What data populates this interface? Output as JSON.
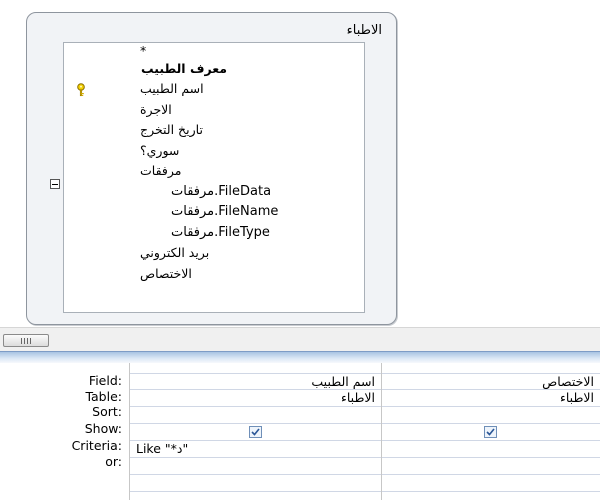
{
  "table_box": {
    "title": "الاطباء",
    "fields": [
      "*",
      "معرف الطبيب",
      "اسم الطبيب",
      "الاجرة",
      "تاريخ التخرج",
      "سوري؟",
      "مرفقات",
      "مرفقات.FileData",
      "مرفقات.FileName",
      "مرفقات.FileType",
      "بريد الكتروني",
      "الاختصاص"
    ]
  },
  "grid": {
    "row_labels": [
      "Field:",
      "Table:",
      "Sort:",
      "Show:",
      "Criteria:",
      "or:"
    ],
    "columns": [
      {
        "field": "اسم الطبيب",
        "table": "الاطباء",
        "sort": "",
        "show": true,
        "criteria": "Like \"*د\"",
        "or": ""
      },
      {
        "field": "الاختصاص",
        "table": "الاطباء",
        "sort": "",
        "show": true,
        "criteria": "",
        "or": ""
      }
    ]
  },
  "icons": {
    "primary_key": "key-icon",
    "collapse": "minus-box-icon",
    "checkbox": "checkmark-icon"
  },
  "colors": {
    "splitter": "#a8c3e3",
    "key": "#e0b800",
    "checkbox_border": "#6f8fb8",
    "grid_line": "#d0d7e5"
  }
}
